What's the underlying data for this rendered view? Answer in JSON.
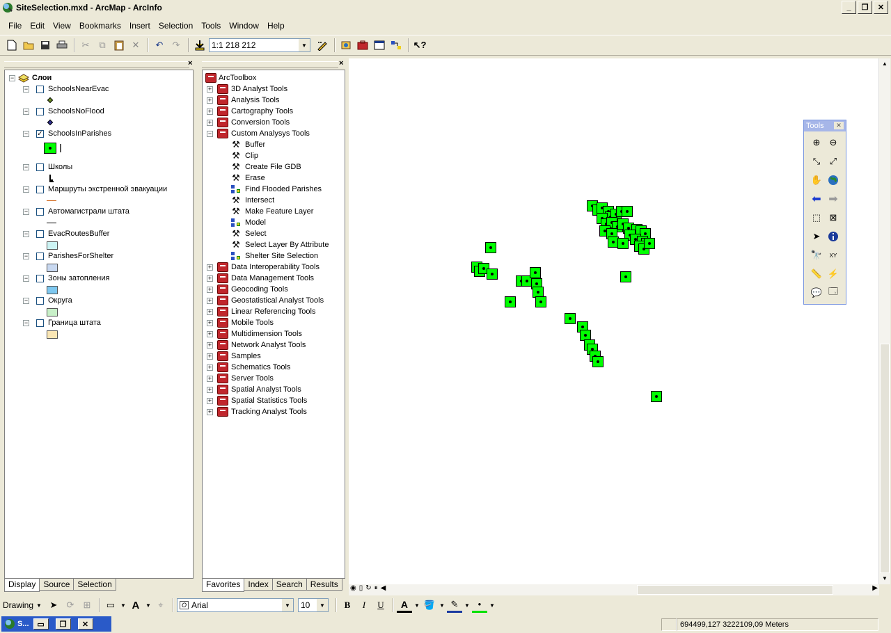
{
  "window": {
    "title": "SiteSelection.mxd - ArcMap - ArcInfo"
  },
  "menu": [
    "File",
    "Edit",
    "View",
    "Bookmarks",
    "Insert",
    "Selection",
    "Tools",
    "Window",
    "Help"
  ],
  "toolbar": {
    "scale": "1:1 218 212"
  },
  "toc": {
    "root": "Слои",
    "layers": [
      {
        "name": "SchoolsNearEvac",
        "checked": false,
        "symbol": "point-diamond",
        "color": "#6b8e23"
      },
      {
        "name": "SchoolsNoFlood",
        "checked": false,
        "symbol": "point-diamond",
        "color": "#2f2f8f"
      },
      {
        "name": "SchoolsInParishes",
        "checked": true,
        "symbol": "green-square",
        "color": "#00ff00"
      },
      {
        "name": "Школы",
        "checked": false,
        "symbol": "school-icon",
        "color": "#000000"
      },
      {
        "name": "Маршруты экстренной эвакуации",
        "checked": false,
        "symbol": "line",
        "color": "#d2691e"
      },
      {
        "name": "Автомагистрали штата",
        "checked": false,
        "symbol": "line",
        "color": "#000000"
      },
      {
        "name": "EvacRoutesBuffer",
        "checked": false,
        "symbol": "fill",
        "color": "#ccf3f3"
      },
      {
        "name": "ParishesForShelter",
        "checked": false,
        "symbol": "fill",
        "color": "#c8d8f0"
      },
      {
        "name": "Зоны затопления",
        "checked": false,
        "symbol": "fill",
        "color": "#7ec8f0"
      },
      {
        "name": "Округа",
        "checked": false,
        "symbol": "fill",
        "color": "#c8f0c8"
      },
      {
        "name": "Граница штата",
        "checked": false,
        "symbol": "fill",
        "color": "#fae6b4"
      }
    ],
    "tabs": [
      "Display",
      "Source",
      "Selection"
    ]
  },
  "arctoolbox": {
    "root": "ArcToolbox",
    "toolboxes_before": [
      "3D Analyst Tools",
      "Analysis Tools",
      "Cartography Tools",
      "Conversion Tools"
    ],
    "custom": {
      "name": "Custom Analysys Tools",
      "tools": [
        {
          "name": "Buffer",
          "type": "tool"
        },
        {
          "name": "Clip",
          "type": "tool"
        },
        {
          "name": "Create File GDB",
          "type": "tool"
        },
        {
          "name": "Erase",
          "type": "tool"
        },
        {
          "name": "Find Flooded Parishes",
          "type": "model"
        },
        {
          "name": "Intersect",
          "type": "tool"
        },
        {
          "name": "Make Feature Layer",
          "type": "tool"
        },
        {
          "name": "Model",
          "type": "model"
        },
        {
          "name": "Select",
          "type": "tool"
        },
        {
          "name": "Select Layer By Attribute",
          "type": "tool"
        },
        {
          "name": "Shelter Site Selection",
          "type": "model"
        }
      ]
    },
    "toolboxes_after": [
      "Data Interoperability Tools",
      "Data Management Tools",
      "Geocoding Tools",
      "Geostatistical Analyst Tools",
      "Linear Referencing Tools",
      "Mobile Tools",
      "Multidimension Tools",
      "Network Analyst Tools",
      "Samples",
      "Schematics Tools",
      "Server Tools",
      "Spatial Analyst Tools",
      "Spatial Statistics Tools",
      "Tracking Analyst Tools"
    ],
    "tabs": [
      "Favorites",
      "Index",
      "Search",
      "Results"
    ]
  },
  "tools_window": {
    "title": "Tools"
  },
  "drawing": {
    "label": "Drawing",
    "font": "Arial",
    "size": "10"
  },
  "status": {
    "coords": "694499,127  3222109,09 Meters",
    "taskbar": "S..."
  }
}
